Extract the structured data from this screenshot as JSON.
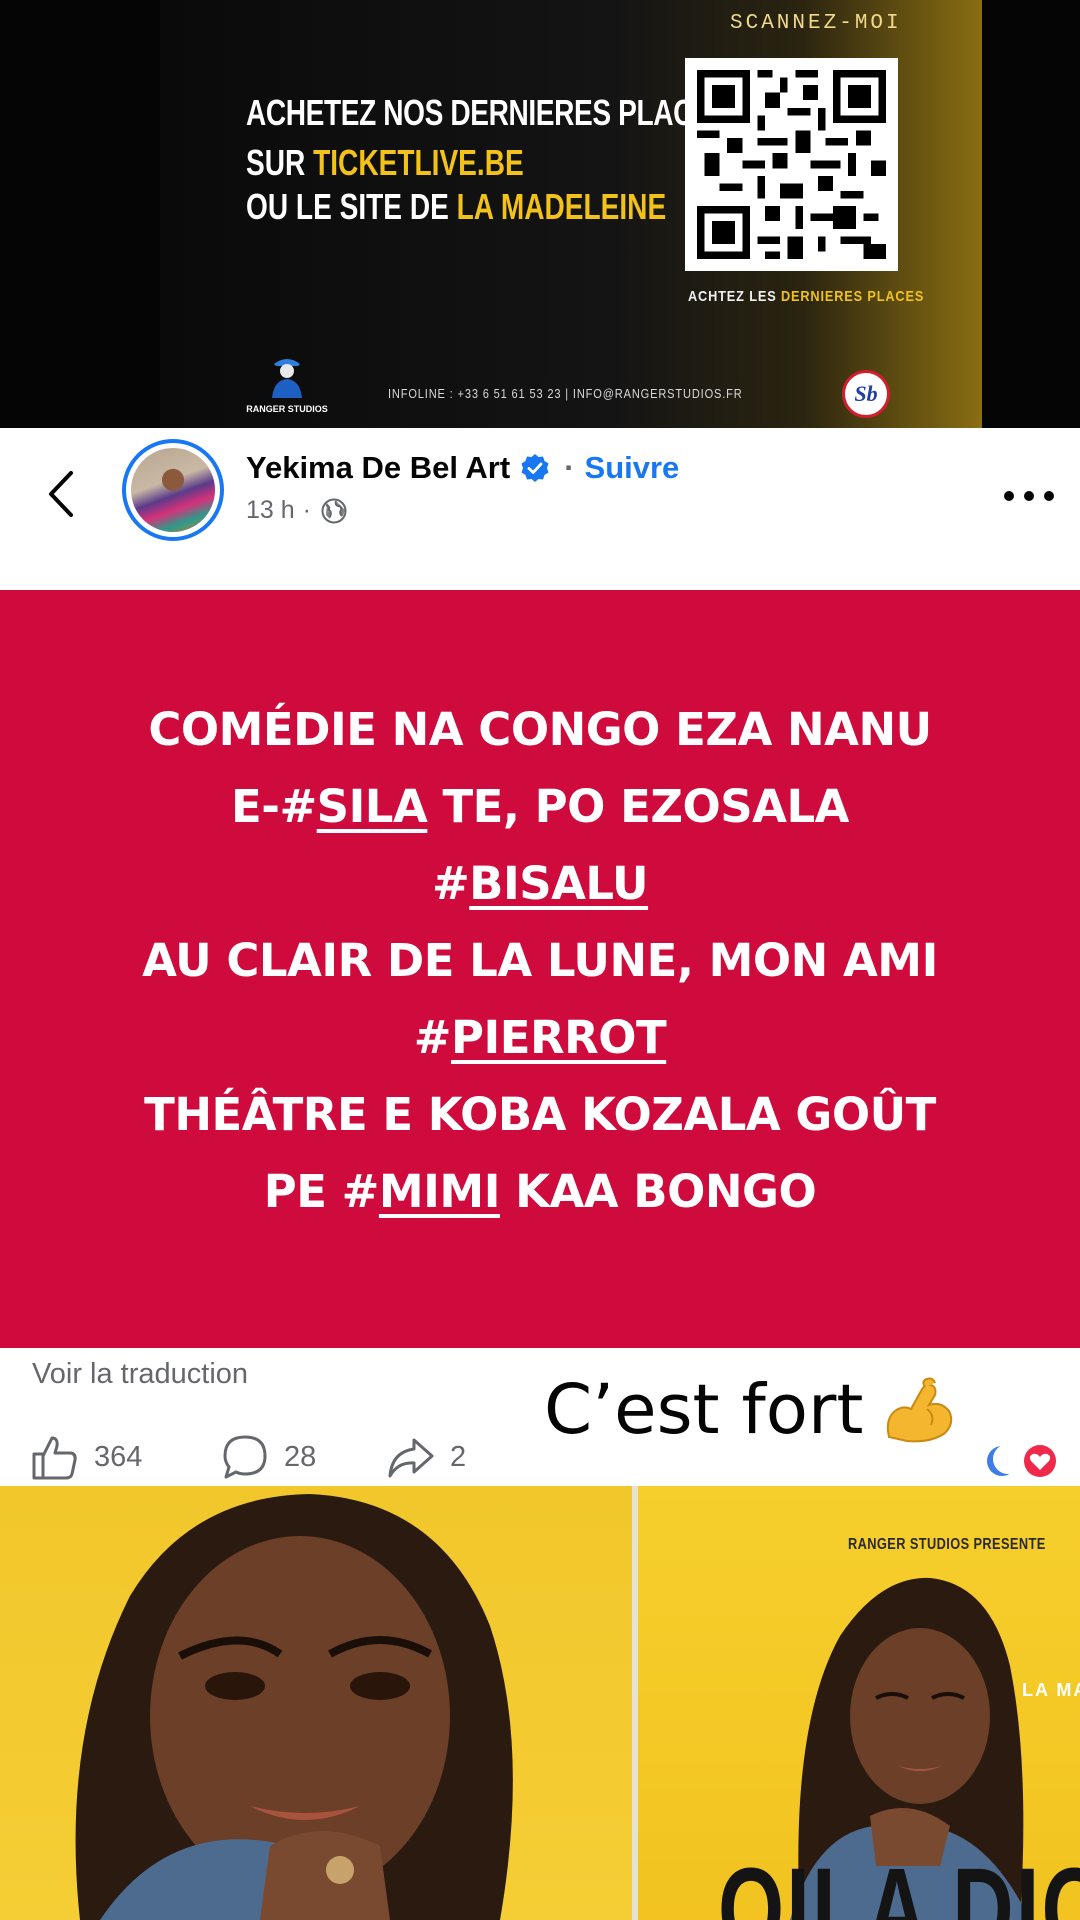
{
  "poster_top": {
    "scan_label": "SCANNEZ-MOI",
    "headline": "ACHETEZ NOS DERNIERES PLACES",
    "line1_prefix": "SUR ",
    "line1_highlight": "TICKETLIVE.BE",
    "line2_prefix": "OU LE SITE DE ",
    "line2_highlight": "LA MADELEINE",
    "qr_caption_prefix": "ACHTEZ LES ",
    "qr_caption_highlight": "DERNIERES PLACES",
    "info_line": "INFOLINE : +33 6 51 61 53 23  | INFO@RANGERSTUDIOS.FR",
    "ranger_logo_text": "RANGER STUDIOS",
    "sb_logo_text": "Sb"
  },
  "post": {
    "author": "Yekima De Bel Art",
    "follow_label": "Suivre",
    "time": "13 h",
    "separator": "·",
    "text_lines": [
      {
        "before": "COMÉDIE NA CONGO EZA NANU",
        "tag": "",
        "after": ""
      },
      {
        "before": "E-#",
        "tag": "SILA",
        "after": " TE, PO EZOSALA"
      },
      {
        "before": "#",
        "tag": "BISALU",
        "after": ""
      },
      {
        "before": "AU CLAIR DE LA LUNE, MON AMI",
        "tag": "",
        "after": ""
      },
      {
        "before": "#",
        "tag": "PIERROT",
        "after": ""
      },
      {
        "before": "THÉÂTRE E KOBA KOZALA GOÛT",
        "tag": "",
        "after": ""
      },
      {
        "before": "PE #",
        "tag": "MIMI",
        "after": " KAA BONGO"
      }
    ],
    "translate_label": "Voir la traduction",
    "caption": "C’est fort",
    "likes": "364",
    "comments": "28",
    "shares": "2"
  },
  "poster_bottom": {
    "presenter": "RANGER STUDIOS PRESENTE",
    "venue_partial": "LA MA",
    "title_partial": "OILA DIOA"
  },
  "colors": {
    "accent_blue": "#1877f2",
    "post_background": "#cf0a3c",
    "poster_yellow": "#f2c21a",
    "meta_gray": "#65676b"
  },
  "icons": [
    "back-chevron-icon",
    "verified-badge-icon",
    "globe-icon",
    "more-options-icon",
    "like-icon",
    "comment-icon",
    "share-icon",
    "flexed-biceps-icon",
    "reaction-icons"
  ]
}
